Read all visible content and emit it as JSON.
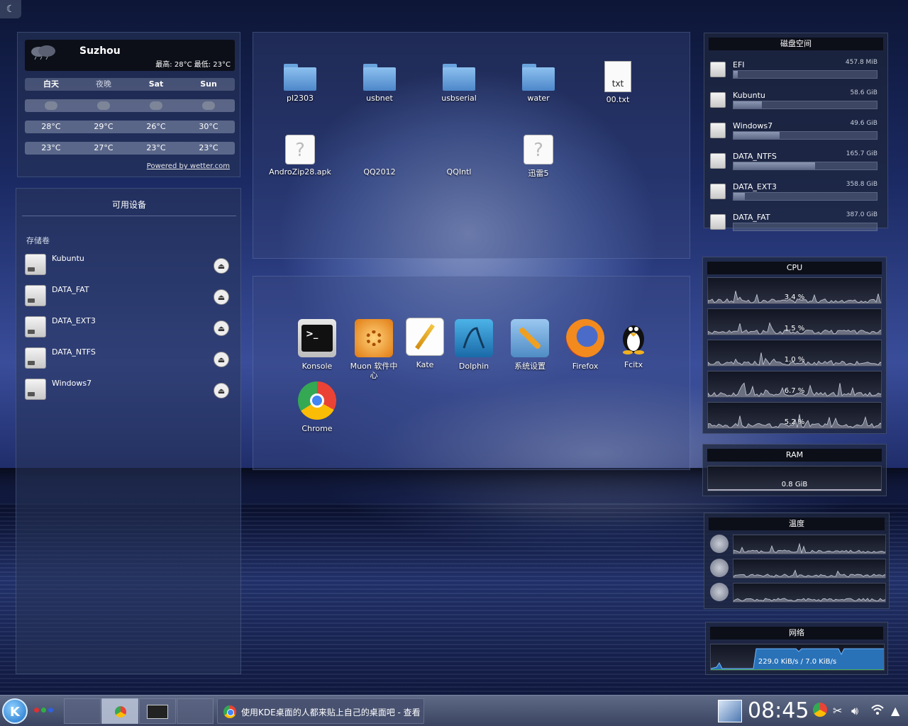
{
  "weather": {
    "city": "Suzhou",
    "high_low": "最高: 28°C 最低: 23°C",
    "days": [
      "白天",
      "夜晚",
      "Sat",
      "Sun"
    ],
    "highs": [
      "28°C",
      "29°C",
      "26°C",
      "30°C"
    ],
    "lows": [
      "23°C",
      "27°C",
      "23°C",
      "23°C"
    ],
    "powered": "Powered by wetter.com"
  },
  "devices": {
    "title": "可用设备",
    "section": "存储卷",
    "items": [
      {
        "name": "Kubuntu"
      },
      {
        "name": "DATA_FAT"
      },
      {
        "name": "DATA_EXT3"
      },
      {
        "name": "DATA_NTFS"
      },
      {
        "name": "Windows7"
      }
    ]
  },
  "folder": {
    "items": [
      {
        "label": "pl2303",
        "icon": "folder-icon"
      },
      {
        "label": "usbnet",
        "icon": "folder-icon"
      },
      {
        "label": "usbserial",
        "icon": "folder-icon"
      },
      {
        "label": "water",
        "icon": "folder-icon"
      },
      {
        "label": "00.txt",
        "icon": "text-file-icon",
        "glyph": "txt"
      },
      {
        "label": "AndroZip28.apk",
        "icon": "unknown-file-icon"
      },
      {
        "label": "QQ2012",
        "icon": "unknown-file-icon"
      },
      {
        "label": "QQIntl",
        "icon": "unknown-file-icon"
      },
      {
        "label": "迅雷5",
        "icon": "unknown-file-icon"
      }
    ]
  },
  "launcher": {
    "apps": [
      {
        "label": "Konsole",
        "icon": "terminal-icon"
      },
      {
        "label": "Muon 软件中心",
        "icon": "muon-icon"
      },
      {
        "label": "Kate",
        "icon": "kate-icon"
      },
      {
        "label": "Dolphin",
        "icon": "dolphin-icon"
      },
      {
        "label": "系统设置",
        "icon": "settings-icon"
      },
      {
        "label": "Firefox",
        "icon": "firefox-icon"
      },
      {
        "label": "Fcitx",
        "icon": "penguin-icon"
      },
      {
        "label": "Chrome",
        "icon": "chrome-icon"
      }
    ]
  },
  "disk": {
    "title": "磁盘空间",
    "items": [
      {
        "name": "EFI",
        "size": "457.8 MiB",
        "used_fraction": 0.03
      },
      {
        "name": "Kubuntu",
        "size": "58.6 GiB",
        "used_fraction": 0.2
      },
      {
        "name": "Windows7",
        "size": "49.6 GiB",
        "used_fraction": 0.32
      },
      {
        "name": "DATA_NTFS",
        "size": "165.7 GiB",
        "used_fraction": 0.57
      },
      {
        "name": "DATA_EXT3",
        "size": "358.8 GiB",
        "used_fraction": 0.08
      },
      {
        "name": "DATA_FAT",
        "size": "387.0 GiB",
        "used_fraction": 0.0
      }
    ]
  },
  "cpu": {
    "title": "CPU",
    "cores": [
      "3.4 %",
      "1.5 %",
      "1.0 %",
      "6.7 %",
      "5.2 %"
    ]
  },
  "ram": {
    "title": "RAM",
    "value": "0.8 GiB"
  },
  "temp": {
    "title": "温度"
  },
  "network": {
    "title": "网络",
    "value": "229.0 KiB/s / 7.0 KiB/s"
  },
  "taskbar": {
    "task_title": "使用KDE桌面的人都来贴上自己的桌面吧 - 查看",
    "clock": "08:45"
  },
  "colors": {
    "dot_red": "#e03030",
    "dot_green": "#30b040",
    "dot_blue": "#3060e0"
  }
}
